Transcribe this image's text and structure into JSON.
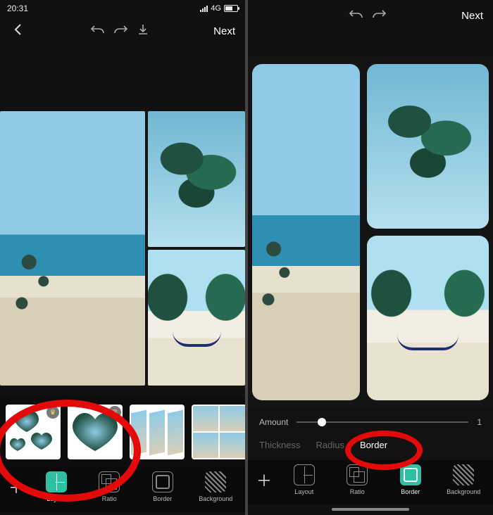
{
  "left": {
    "status": {
      "time": "20:31",
      "net": "4G"
    },
    "nav": {
      "next": "Next"
    },
    "templates": [
      {
        "id": "hearts-3",
        "premium": true
      },
      {
        "id": "heart-1",
        "premium": true
      },
      {
        "id": "skew-3",
        "premium": false
      },
      {
        "id": "grid-4",
        "premium": false
      }
    ],
    "tools": [
      {
        "key": "layout",
        "label": "Layout",
        "active": true
      },
      {
        "key": "ratio",
        "label": "Ratio",
        "active": false
      },
      {
        "key": "border",
        "label": "Border",
        "active": false
      },
      {
        "key": "background",
        "label": "Background",
        "active": false
      }
    ]
  },
  "right": {
    "nav": {
      "next": "Next"
    },
    "border_panel": {
      "amount_label": "Amount",
      "amount_value": "1",
      "subtabs": [
        {
          "key": "thickness",
          "label": "Thickness",
          "selected": false
        },
        {
          "key": "radius",
          "label": "Radius",
          "selected": false
        },
        {
          "key": "border",
          "label": "Border",
          "selected": true
        }
      ]
    },
    "tools": [
      {
        "key": "layout",
        "label": "Layout",
        "active": false
      },
      {
        "key": "ratio",
        "label": "Ratio",
        "active": false
      },
      {
        "key": "border",
        "label": "Border",
        "active": true
      },
      {
        "key": "background",
        "label": "Background",
        "active": false
      }
    ]
  }
}
